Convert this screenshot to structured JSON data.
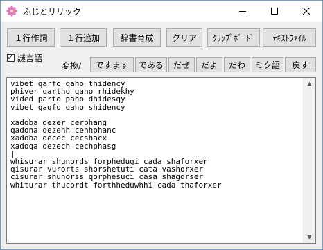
{
  "window": {
    "title": "ふじとリリック",
    "icon": "flower-icon",
    "controls": [
      "minimize-icon",
      "maximize-icon",
      "close-icon"
    ]
  },
  "toolbar": {
    "line_copy": "１行作詞",
    "line_add": "１行追加",
    "dictionary": "辞書育成",
    "clear": "クリア",
    "clipboard": "ｸﾘｯﾌﾟﾎﾞｰﾄﾞ",
    "text_file": "ﾃｷｽﾄﾌｧｲﾙ"
  },
  "options": {
    "riddle_checkbox_label": "謎言語",
    "riddle_checked": true,
    "conversion_label": "変換/"
  },
  "conversion_buttons": [
    "ですます",
    "である",
    "だぜ",
    "だよ",
    "だわ",
    "ミク語",
    "戻す"
  ],
  "editor": {
    "text": "vibet qarfo qaho thidency\nphiver qartho qaho rhidekhy\nvided parto paho dhidesqy\nvibet qaqfo qaho shidency\n\nxadoba dezer cerphang\nqadona dezehh cehhphanc\nxadoba decec cecshacx\nxadoqa dezech cechphasg\n|\nwhisurar shunords forphedugi cada shaforxer\nqisurar vurorts shorshetuti cata vashorxer\ncisurar shunorss qorphesuci casa shagorser\nwhiturar thucordt forthheduwhhi cada thaforxer"
  },
  "colors": {
    "titlebar_bg": "#ffffff",
    "window_bg": "#f0f0f0",
    "button_bg": "#e1e1e1",
    "button_border": "#adadad",
    "editor_border": "#7a7a7a"
  }
}
